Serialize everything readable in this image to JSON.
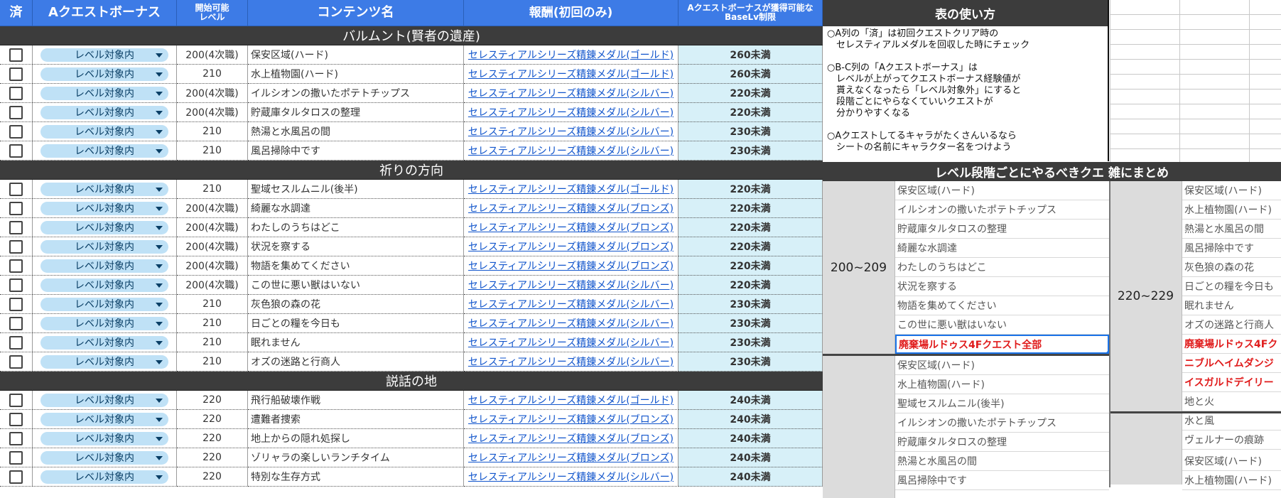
{
  "headers": {
    "done": "済",
    "bonus": "Aクエストボーナス",
    "start_level": "開始可能\nレベル",
    "content_name": "コンテンツ名",
    "reward": "報酬(初回のみ)",
    "limit": "Aクエストボーナスが獲得可能な\nBaseLv制限"
  },
  "sections": [
    {
      "title": "バルムント(賢者の遺産)",
      "rows": [
        {
          "bonus": "レベル対象内",
          "level": "200(4次職)",
          "name": "保安区域(ハード)",
          "reward": "セレスティアルシリーズ精錬メダル(ゴールド)",
          "limit": "260未満"
        },
        {
          "bonus": "レベル対象内",
          "level": "210",
          "name": "水上植物園(ハード)",
          "reward": "セレスティアルシリーズ精錬メダル(ゴールド)",
          "limit": "260未満"
        },
        {
          "bonus": "レベル対象内",
          "level": "200(4次職)",
          "name": "イルシオンの撒いたポテトチップス",
          "reward": "セレスティアルシリーズ精錬メダル(シルバー)",
          "limit": "220未満"
        },
        {
          "bonus": "レベル対象内",
          "level": "200(4次職)",
          "name": "貯蔵庫タルタロスの整理",
          "reward": "セレスティアルシリーズ精錬メダル(シルバー)",
          "limit": "220未満"
        },
        {
          "bonus": "レベル対象内",
          "level": "210",
          "name": "熱湯と水風呂の間",
          "reward": "セレスティアルシリーズ精錬メダル(シルバー)",
          "limit": "230未満"
        },
        {
          "bonus": "レベル対象内",
          "level": "210",
          "name": "風呂掃除中です",
          "reward": "セレスティアルシリーズ精錬メダル(シルバー)",
          "limit": "230未満"
        }
      ]
    },
    {
      "title": "祈りの方向",
      "rows": [
        {
          "bonus": "レベル対象内",
          "level": "210",
          "name": "聖域セスルムニル(後半)",
          "reward": "セレスティアルシリーズ精錬メダル(ゴールド)",
          "limit": "220未満"
        },
        {
          "bonus": "レベル対象内",
          "level": "200(4次職)",
          "name": "綺麗な水調達",
          "reward": "セレスティアルシリーズ精錬メダル(ブロンズ)",
          "limit": "220未満"
        },
        {
          "bonus": "レベル対象内",
          "level": "200(4次職)",
          "name": "わたしのうちはどこ",
          "reward": "セレスティアルシリーズ精錬メダル(ブロンズ)",
          "limit": "220未満"
        },
        {
          "bonus": "レベル対象内",
          "level": "200(4次職)",
          "name": "状況を察する",
          "reward": "セレスティアルシリーズ精錬メダル(ブロンズ)",
          "limit": "220未満"
        },
        {
          "bonus": "レベル対象内",
          "level": "200(4次職)",
          "name": "物語を集めてください",
          "reward": "セレスティアルシリーズ精錬メダル(ブロンズ)",
          "limit": "220未満"
        },
        {
          "bonus": "レベル対象内",
          "level": "200(4次職)",
          "name": "この世に悪い獣はいない",
          "reward": "セレスティアルシリーズ精錬メダル(シルバー)",
          "limit": "220未満"
        },
        {
          "bonus": "レベル対象内",
          "level": "210",
          "name": "灰色狼の森の花",
          "reward": "セレスティアルシリーズ精錬メダル(シルバー)",
          "limit": "230未満"
        },
        {
          "bonus": "レベル対象内",
          "level": "210",
          "name": "日ごとの糧を今日も",
          "reward": "セレスティアルシリーズ精錬メダル(シルバー)",
          "limit": "230未満"
        },
        {
          "bonus": "レベル対象内",
          "level": "210",
          "name": "眠れません",
          "reward": "セレスティアルシリーズ精錬メダル(シルバー)",
          "limit": "230未満"
        },
        {
          "bonus": "レベル対象内",
          "level": "210",
          "name": "オズの迷路と行商人",
          "reward": "セレスティアルシリーズ精錬メダル(シルバー)",
          "limit": "230未満"
        }
      ]
    },
    {
      "title": "説話の地",
      "rows": [
        {
          "bonus": "レベル対象内",
          "level": "220",
          "name": "飛行船破壊作戦",
          "reward": "セレスティアルシリーズ精錬メダル(ゴールド)",
          "limit": "240未満"
        },
        {
          "bonus": "レベル対象内",
          "level": "220",
          "name": "遭難者捜索",
          "reward": "セレスティアルシリーズ精錬メダル(ブロンズ)",
          "limit": "240未満"
        },
        {
          "bonus": "レベル対象内",
          "level": "220",
          "name": "地上からの隠れ処探し",
          "reward": "セレスティアルシリーズ精錬メダル(ブロンズ)",
          "limit": "240未満"
        },
        {
          "bonus": "レベル対象内",
          "level": "220",
          "name": "ゾリャラの楽しいランチタイム",
          "reward": "セレスティアルシリーズ精錬メダル(ブロンズ)",
          "limit": "240未満"
        },
        {
          "bonus": "レベル対象内",
          "level": "220",
          "name": "特別な生存方式",
          "reward": "セレスティアルシリーズ精錬メダル(シルバー)",
          "limit": "240未満"
        }
      ]
    }
  ],
  "howto": {
    "title": "表の使い方",
    "lines": [
      "○A列の「済」は初回クエストクリア時の",
      "　セレスティアルメダルを回収した時にチェック",
      "",
      "○B-C列の「Aクエストボーナス」は",
      "　レベルが上がってクエストボーナス経験値が",
      "　貰えなくなったら「レベル対象外」にすると",
      "　段階ごとにやらなくていいクエストが",
      "　分かりやすくなる",
      "",
      "○Aクエストしてるキャラがたくさんいるなら",
      "　シートの名前にキャラクター名をつけよう"
    ]
  },
  "summary": {
    "title": "レベル段階ごとにやるべきクエ 雑にまとめ",
    "group1": {
      "range": "200~209",
      "items": [
        "保安区域(ハード)",
        "イルシオンの撒いたポテトチップス",
        "貯蔵庫タルタロスの整理",
        "綺麗な水調達",
        "わたしのうちはどこ",
        "状況を察する",
        "物語を集めてください",
        "この世に悪い獣はいない"
      ],
      "red": "廃棄場ルドゥス4Fクエスト全部"
    },
    "group2": {
      "items": [
        "保安区域(ハード)",
        "水上植物園(ハード)",
        "聖域セスルムニル(後半)",
        "イルシオンの撒いたポテトチップス",
        "貯蔵庫タルタロスの整理",
        "熱湯と水風呂の間",
        "風呂掃除中です"
      ]
    },
    "group3": {
      "range": "220~229",
      "items": [
        "保安区域(ハード)",
        "水上植物園(ハード)",
        "熱湯と水風呂の間",
        "風呂掃除中です",
        "灰色狼の森の花",
        "日ごとの糧を今日も",
        "眠れません",
        "オズの迷路と行商人"
      ],
      "red": [
        "廃棄場ルドゥス4Fク",
        "ニブルヘイムダンジ",
        "イスガルドデイリー"
      ],
      "after": [
        "地と火",
        "水と風",
        "ヴェルナーの痕跡"
      ]
    },
    "group4": {
      "items": [
        "保安区域(ハード)",
        "水上植物園(ハード)"
      ]
    }
  }
}
